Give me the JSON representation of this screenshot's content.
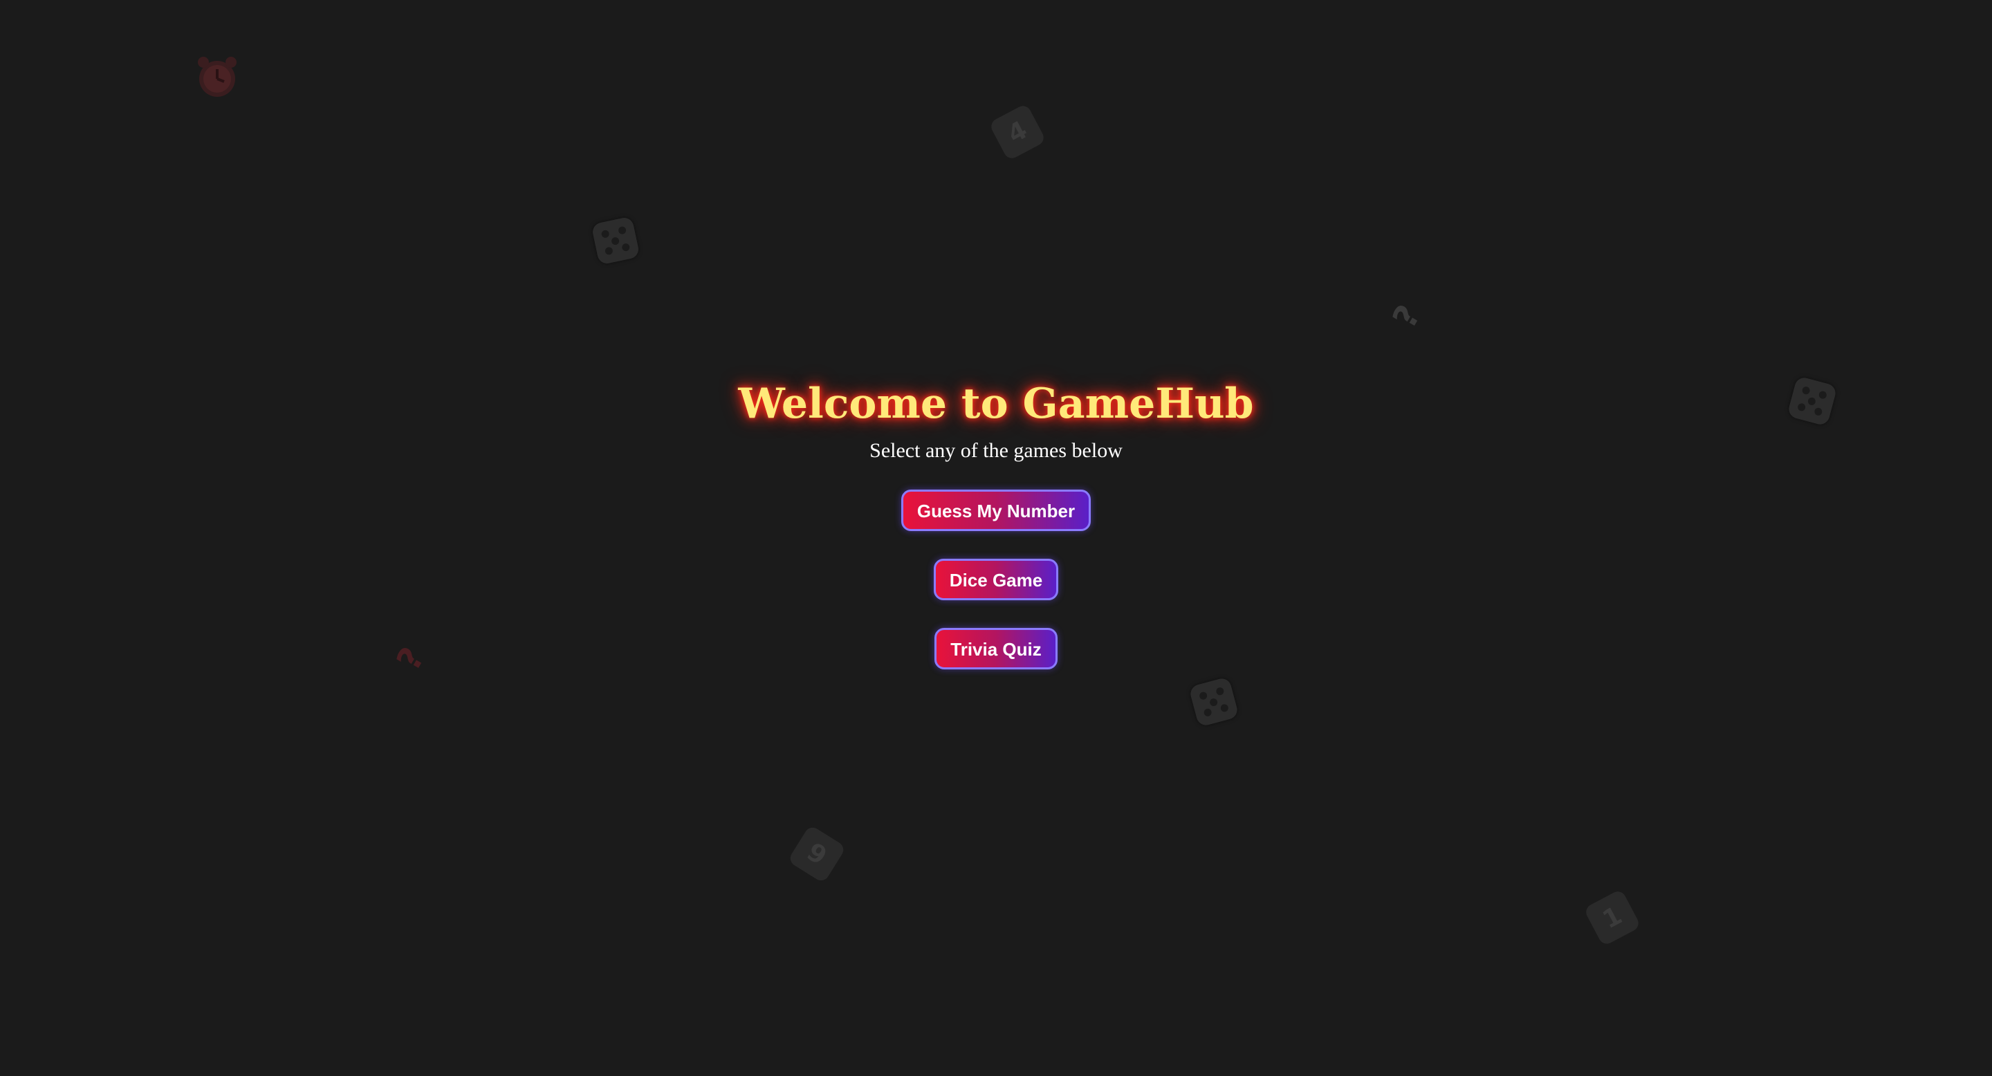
{
  "title": "Welcome to GameHub",
  "subtitle": "Select any of the games below",
  "games": [
    {
      "label": "Guess My Number"
    },
    {
      "label": "Dice Game"
    },
    {
      "label": "Trivia Quiz"
    }
  ],
  "background": {
    "number_tiles": [
      "4",
      "9",
      "1"
    ],
    "question_mark": "?",
    "icons": [
      "alarm-clock-icon",
      "die-icon",
      "die-icon",
      "die-icon",
      "question-mark-icon",
      "question-mark-icon",
      "number-tile-icon"
    ]
  },
  "colors": {
    "background": "#1b1b1b",
    "title": "#ffe97a",
    "title_glow": "#ff2a1a",
    "button_start": "#e8133a",
    "button_end": "#5a1fc8",
    "button_border": "#8b7bff"
  }
}
